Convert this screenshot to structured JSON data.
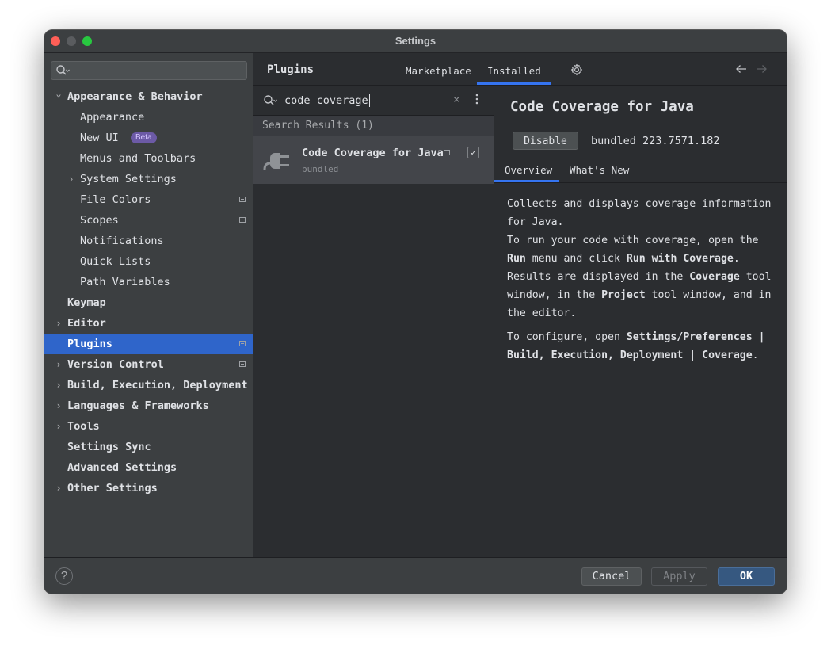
{
  "window": {
    "title": "Settings"
  },
  "sidebar": {
    "search_placeholder": "",
    "items": [
      {
        "label": "Appearance & Behavior",
        "expanded": true,
        "level": 0
      },
      {
        "label": "Appearance",
        "level": 1
      },
      {
        "label": "New UI",
        "level": 1,
        "badge": "Beta"
      },
      {
        "label": "Menus and Toolbars",
        "level": 1
      },
      {
        "label": "System Settings",
        "level": 1,
        "expandable": true
      },
      {
        "label": "File Colors",
        "level": 1
      },
      {
        "label": "Scopes",
        "level": 1
      },
      {
        "label": "Notifications",
        "level": 1
      },
      {
        "label": "Quick Lists",
        "level": 1
      },
      {
        "label": "Path Variables",
        "level": 1
      },
      {
        "label": "Keymap",
        "level": 0
      },
      {
        "label": "Editor",
        "level": 0,
        "expandable": true
      },
      {
        "label": "Plugins",
        "level": 0,
        "selected": true
      },
      {
        "label": "Version Control",
        "level": 0,
        "expandable": true
      },
      {
        "label": "Build, Execution, Deployment",
        "level": 0,
        "expandable": true
      },
      {
        "label": "Languages & Frameworks",
        "level": 0,
        "expandable": true
      },
      {
        "label": "Tools",
        "level": 0,
        "expandable": true
      },
      {
        "label": "Settings Sync",
        "level": 0
      },
      {
        "label": "Advanced Settings",
        "level": 0
      },
      {
        "label": "Other Settings",
        "level": 0,
        "expandable": true
      }
    ]
  },
  "plugins": {
    "header": "Plugins",
    "tabs": [
      "Marketplace",
      "Installed"
    ],
    "active_tab": "Installed",
    "search_value": "code coverage",
    "results_header": "Search Results (1)",
    "result": {
      "name": "Code Coverage for Java",
      "subtitle": "bundled",
      "enabled": true
    }
  },
  "detail": {
    "title": "Code Coverage for Java",
    "disable_label": "Disable",
    "version": "bundled 223.7571.182",
    "tabs": [
      "Overview",
      "What's New"
    ],
    "active_tab": "Overview",
    "desc": {
      "l1": "Collects and displays coverage information for Java.",
      "l2a": "To run your code with coverage, open the ",
      "l2b": "Run",
      "l2c": " menu and click ",
      "l2d": "Run with Coverage",
      "l2e": ".",
      "l3a": "Results are displayed in the ",
      "l3b": "Coverage",
      "l3c": " tool window, in the ",
      "l3d": "Project",
      "l3e": " tool window, and in the editor.",
      "l4a": "To configure, open ",
      "l4b": "Settings/Preferences | Build, Execution, Deployment | Coverage",
      "l4c": "."
    }
  },
  "footer": {
    "help": "?",
    "cancel": "Cancel",
    "apply": "Apply",
    "ok": "OK"
  },
  "colors": {
    "accent": "#3574f0",
    "selection": "#2f65ca",
    "background": "#2b2d30",
    "panel": "#3c3f41"
  }
}
